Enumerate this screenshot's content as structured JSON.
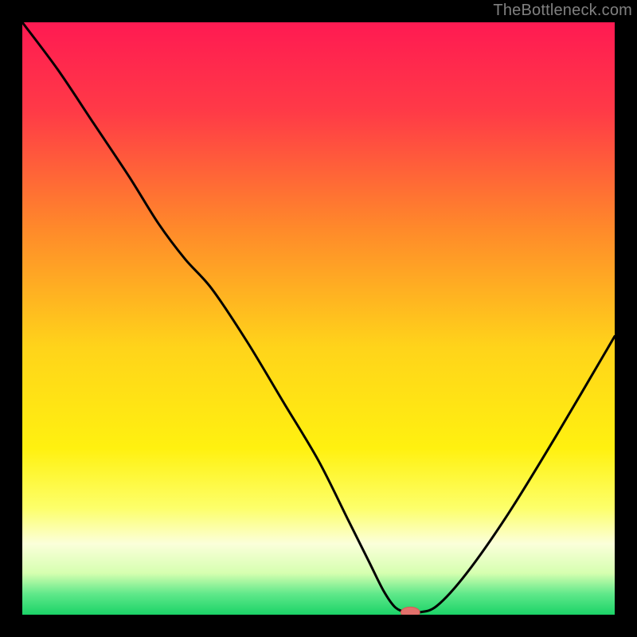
{
  "watermark": "TheBottleneck.com",
  "colors": {
    "bg": "#000000",
    "curve": "#000000",
    "marker_fill": "#e2706b",
    "marker_stroke": "#d85a55",
    "gradient_stops": [
      {
        "offset": 0.0,
        "color": "#ff1a52"
      },
      {
        "offset": 0.15,
        "color": "#ff3a47"
      },
      {
        "offset": 0.35,
        "color": "#ff8a2a"
      },
      {
        "offset": 0.55,
        "color": "#ffd41a"
      },
      {
        "offset": 0.72,
        "color": "#fff110"
      },
      {
        "offset": 0.82,
        "color": "#fdff6a"
      },
      {
        "offset": 0.88,
        "color": "#fbffda"
      },
      {
        "offset": 0.93,
        "color": "#d6ffb0"
      },
      {
        "offset": 0.965,
        "color": "#5fe88a"
      },
      {
        "offset": 1.0,
        "color": "#1bd367"
      }
    ]
  },
  "chart_data": {
    "type": "line",
    "title": "",
    "xlabel": "",
    "ylabel": "",
    "xlim": [
      0,
      100
    ],
    "ylim": [
      0,
      100
    ],
    "grid": false,
    "legend": false,
    "series": [
      {
        "name": "bottleneck-curve",
        "x": [
          0,
          6,
          12,
          18,
          23,
          27.5,
          32,
          38,
          44,
          50,
          55,
          58.5,
          61,
          63,
          65,
          67,
          70,
          75,
          82,
          90,
          100
        ],
        "y": [
          100,
          92,
          83,
          74,
          66,
          60,
          55,
          46,
          36,
          26,
          16,
          9,
          4,
          1.2,
          0.4,
          0.4,
          1.5,
          7,
          17,
          30,
          47
        ]
      }
    ],
    "marker": {
      "x": 65.5,
      "y": 0.4,
      "rx": 1.6,
      "ry": 0.9
    }
  }
}
